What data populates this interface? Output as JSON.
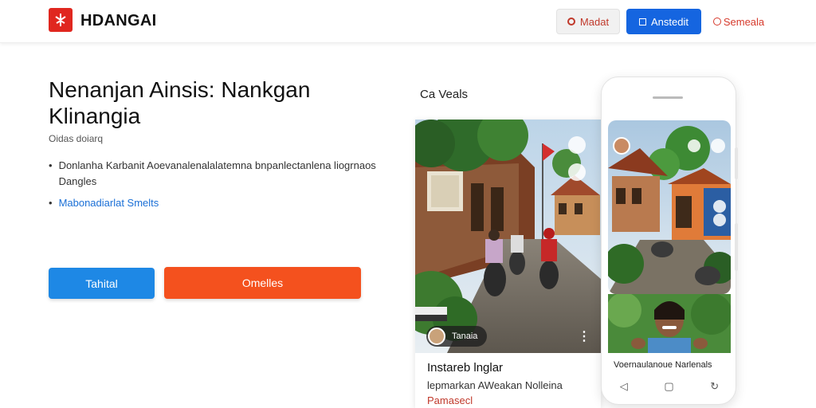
{
  "header": {
    "brand": "HDANGAI",
    "buttons": [
      {
        "label": "Madat",
        "icon": "circle-icon"
      },
      {
        "label": "Anstedit",
        "icon": "square-icon"
      },
      {
        "label": "Semeala",
        "icon": "circle-icon"
      }
    ]
  },
  "hero": {
    "title": "Nenanjan Ainsis: Nankgan Klinangia",
    "subtitle": "Oidas doiarq",
    "bullets": [
      {
        "text": "Donlanha Karbanit Aoevanalenalalatemna bnpanlectanlena liogrnaos Dangles"
      },
      {
        "text": "Mabonadiarlat Smelts"
      }
    ],
    "cta_primary": "Tahital",
    "cta_secondary": "Omelles"
  },
  "section": {
    "label": "Ca Veals"
  },
  "card": {
    "chip_label": "Tanaia",
    "title": "Instareb lnglar",
    "description": "lepmarkan AWeakan Nolleina",
    "tag": "Pamasecl"
  },
  "phone": {
    "caption": "Voernaulanoue Narlenals",
    "nav": [
      "◁",
      "▢",
      "↻"
    ]
  },
  "colors": {
    "brand_red": "#e0271f",
    "primary_blue": "#1e88e5",
    "header_blue": "#1565e0",
    "accent_orange": "#f4511e",
    "link_blue": "#1a6fd6"
  }
}
